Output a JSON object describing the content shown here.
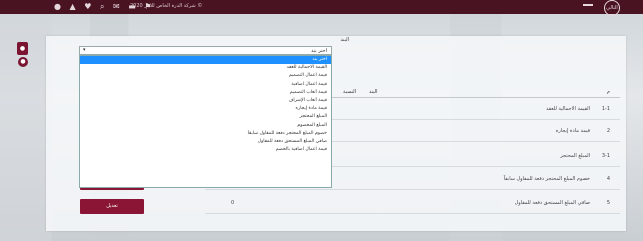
{
  "header": {
    "brand": "شركة الدرة الخاص للاجر 2020 ©",
    "logo_text": "التالي"
  },
  "form": {
    "field_label": "البند",
    "selected_value": "اختر بند"
  },
  "dropdown": {
    "options": [
      "اختر بند",
      "القيمة الاجمالية للعقد",
      "قيمة اعمال التصميم",
      "قيمة اعمال اضافية",
      "قيمة أتعاب التصميم",
      "قيمة أتعاب الإشراف",
      "قيمة مادة إيجاره",
      "المبلغ المحتجز",
      "المبلغ المخصوم",
      "خصوم المبلغ المحتجز دفعة للمقاول سابقاً",
      "صافي المبلغ المستحق دفعة للمقاول",
      "قيمة اعمال اضافية بالخصم"
    ]
  },
  "table": {
    "headers": {
      "index": "م",
      "item": "البند",
      "percent": "النسبة"
    },
    "rows": [
      {
        "num": "1-1",
        "name": "القيمة الاجمالية للعقد",
        "value": ""
      },
      {
        "num": "2",
        "name": "قيمة مادة إيجاره",
        "value": ""
      },
      {
        "num": "3-1",
        "name": "المبلغ المحتجز",
        "value": ""
      },
      {
        "num": "4",
        "name": "خصوم المبلغ المحتجز دفعة للمقاول سابقاً",
        "value": ""
      },
      {
        "num": "5",
        "name": "صافي المبلغ المستحق دفعة للمقاول",
        "value": "0"
      }
    ]
  },
  "buttons": {
    "edit_label": "تعديل"
  },
  "colors": {
    "primary": "#8b1535",
    "header_bg": "#4a1322",
    "selected_option": "#1e90ff"
  }
}
